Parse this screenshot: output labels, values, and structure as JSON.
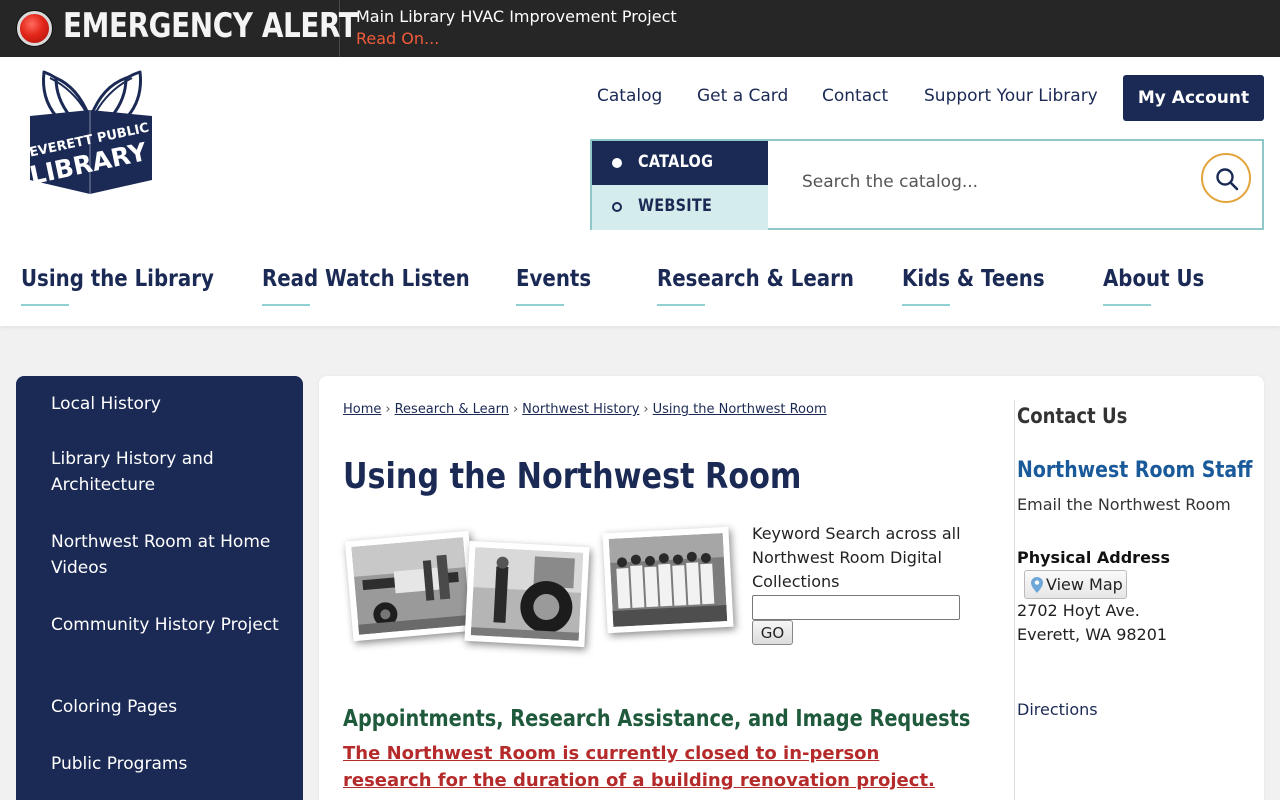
{
  "alert": {
    "title": "EMERGENCY ALERT",
    "message": "Main Library HVAC Improvement Project",
    "link": "Read On..."
  },
  "header": {
    "logo_text": [
      "EVERETT PUBLIC",
      "LIBRARY"
    ],
    "top_links": [
      "Catalog",
      "Get a Card",
      "Contact",
      "Support Your Library"
    ],
    "account_button": "My Account",
    "search": {
      "options": [
        "CATALOG",
        "WEBSITE"
      ],
      "selected": "CATALOG",
      "placeholder": "Search the catalog..."
    },
    "main_nav": [
      "Using the Library",
      "Read Watch Listen",
      "Events",
      "Research & Learn",
      "Kids & Teens",
      "About Us"
    ]
  },
  "sidebar": {
    "items": [
      "Local History",
      "Library History and Architecture",
      "Northwest Room at Home Videos",
      "Community History Project",
      "Coloring Pages",
      "Public Programs"
    ]
  },
  "content": {
    "breadcrumb": [
      "Home",
      "Research & Learn",
      "Northwest History",
      "Using the Northwest Room"
    ],
    "breadcrumb_sep": "›",
    "title": "Using the Northwest Room",
    "keyword_label": "Keyword Search across all Northwest Room Digital Collections",
    "go_button": "GO",
    "section_heading": "Appointments, Research Assistance, and Image Requests",
    "closure_notice": "The Northwest Room is currently closed to in-person research for the duration of a building renovation project."
  },
  "contact": {
    "heading": "Contact Us",
    "staff_link": "Northwest Room Staff",
    "email_link": "Email the Northwest Room",
    "address_label": "Physical Address",
    "map_button": "View Map",
    "address_line1": "2702 Hoyt Ave.",
    "address_line2": "Everett, WA 98201",
    "directions": "Directions"
  },
  "colors": {
    "navy": "#1b2a55",
    "teal_border": "#8fc8c8",
    "alert_bg": "#262626",
    "alert_link": "#f25b3a",
    "heading_green": "#1f5a3c",
    "notice_red": "#b52a2a",
    "link_blue": "#1a5a9a",
    "search_ring": "#e2a43a"
  },
  "icons": [
    "alert-light-icon",
    "search-icon",
    "map-pin-icon",
    "library-logo"
  ]
}
